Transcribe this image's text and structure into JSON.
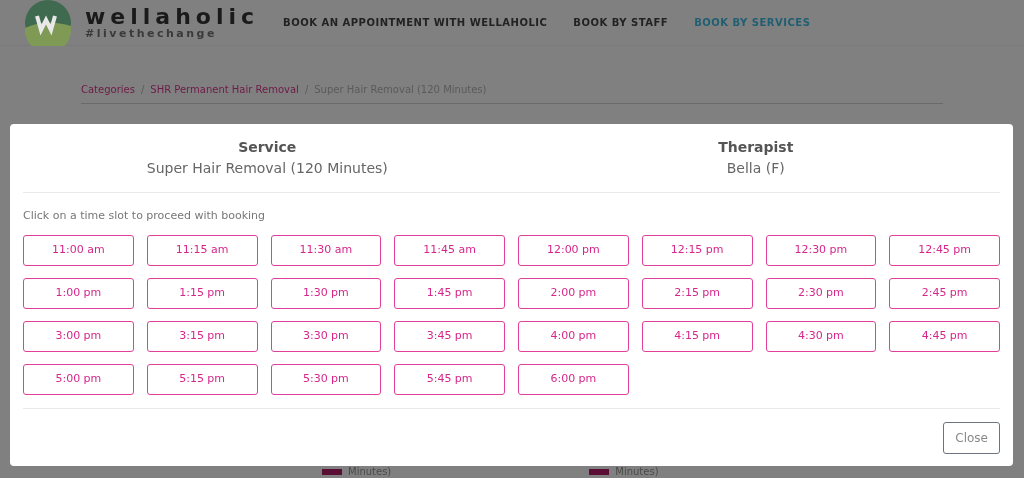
{
  "header": {
    "brand": "wellaholic",
    "tagline": "#livethechange",
    "nav": [
      {
        "label": "BOOK AN APPOINTMENT WITH WELLAHOLIC",
        "selected": false
      },
      {
        "label": "BOOK BY STAFF",
        "selected": false
      },
      {
        "label": "BOOK BY SERVICES",
        "selected": true
      }
    ]
  },
  "breadcrumb": {
    "separator": "/",
    "items": [
      "Categories",
      "SHR Permanent Hair Removal",
      "Super Hair Removal (120 Minutes)"
    ]
  },
  "background_fragments": [
    "Minutes)",
    "Minutes)"
  ],
  "modal": {
    "service_label": "Service",
    "service": "Super Hair Removal (120 Minutes)",
    "therapist_label": "Therapist",
    "therapist": "Bella (F)",
    "instruction": "Click on a time slot to proceed with booking",
    "slots": [
      "11:00 am",
      "11:15 am",
      "11:30 am",
      "11:45 am",
      "12:00 pm",
      "12:15 pm",
      "12:30 pm",
      "12:45 pm",
      "1:00 pm",
      "1:15 pm",
      "1:30 pm",
      "1:45 pm",
      "2:00 pm",
      "2:15 pm",
      "2:30 pm",
      "2:45 pm",
      "3:00 pm",
      "3:15 pm",
      "3:30 pm",
      "3:45 pm",
      "4:00 pm",
      "4:15 pm",
      "4:30 pm",
      "4:45 pm",
      "5:00 pm",
      "5:15 pm",
      "5:30 pm",
      "5:45 pm",
      "6:00 pm"
    ],
    "close": "Close"
  }
}
